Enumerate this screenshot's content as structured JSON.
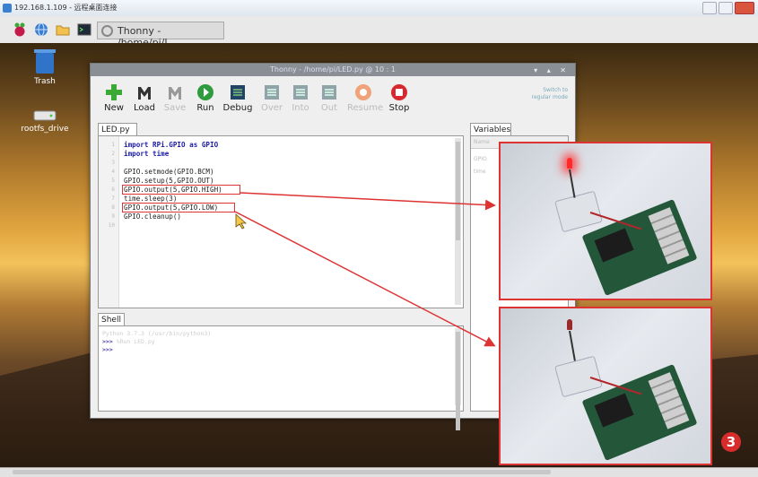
{
  "window": {
    "title": "192.168.1.109 - 远程桌面连接"
  },
  "taskbar": {
    "items": [
      {
        "name": "raspberry-menu-icon"
      },
      {
        "name": "web-browser-icon"
      },
      {
        "name": "file-manager-icon"
      },
      {
        "name": "terminal-icon"
      }
    ],
    "task_label": "Thonny - /home/pi/L..."
  },
  "desktop": {
    "icons": [
      {
        "label": "Trash"
      },
      {
        "label": "rootfs_drive"
      }
    ]
  },
  "thonny": {
    "title": "Thonny - /home/pi/LED.py @ 10 : 1",
    "toolbar": [
      {
        "label": "New",
        "icon": "new-icon",
        "color": "#3aa935",
        "enabled": true
      },
      {
        "label": "Load",
        "icon": "load-icon",
        "color": "#333333",
        "enabled": true
      },
      {
        "label": "Save",
        "icon": "save-icon",
        "color": "#999999",
        "enabled": false
      },
      {
        "label": "Run",
        "icon": "run-icon",
        "color": "#2e9b3f",
        "enabled": true
      },
      {
        "label": "Debug",
        "icon": "debug-icon",
        "color": "#224466",
        "enabled": true
      },
      {
        "label": "Over",
        "icon": "step-over-icon",
        "color": "#8fa3a8",
        "enabled": false
      },
      {
        "label": "Into",
        "icon": "step-into-icon",
        "color": "#8fa3a8",
        "enabled": false
      },
      {
        "label": "Out",
        "icon": "step-out-icon",
        "color": "#8fa3a8",
        "enabled": false
      },
      {
        "label": "Resume",
        "icon": "resume-icon",
        "color": "#f0a27a",
        "enabled": false
      },
      {
        "label": "Stop",
        "icon": "stop-icon",
        "color": "#d8282f",
        "enabled": true
      }
    ],
    "help": {
      "line1": "Switch to",
      "line2": "regular mode"
    },
    "editor": {
      "tab_label": "LED.py ✕",
      "lines": [
        "import RPi.GPIO as GPIO",
        "import time",
        "",
        "GPIO.setmode(GPIO.BCM)",
        "GPIO.setup(5,GPIO.OUT)",
        "GPIO.output(5,GPIO.HIGH)",
        "time.sleep(3)",
        "GPIO.output(5,GPIO.LOW)",
        "GPIO.cleanup()",
        ""
      ],
      "line_numbers": [
        "1",
        "2",
        "3",
        "4",
        "5",
        "6",
        "7",
        "8",
        "9",
        "10"
      ],
      "highlighted_lines": [
        6,
        8
      ]
    },
    "shell": {
      "tab_label": "Shell",
      "lines": [
        {
          "prompt": "",
          "text": "Python 3.7.3 (/usr/bin/python3)"
        },
        {
          "prompt": ">>>",
          "text": " %Run LED.py"
        },
        {
          "prompt": ">>>",
          "text": ""
        }
      ]
    },
    "variables": {
      "tab_label": "Variables",
      "header": "Name",
      "rows": [
        "GPIO",
        "time"
      ]
    }
  },
  "annotation": {
    "step_number": "3",
    "accent": "#d82c2c"
  }
}
